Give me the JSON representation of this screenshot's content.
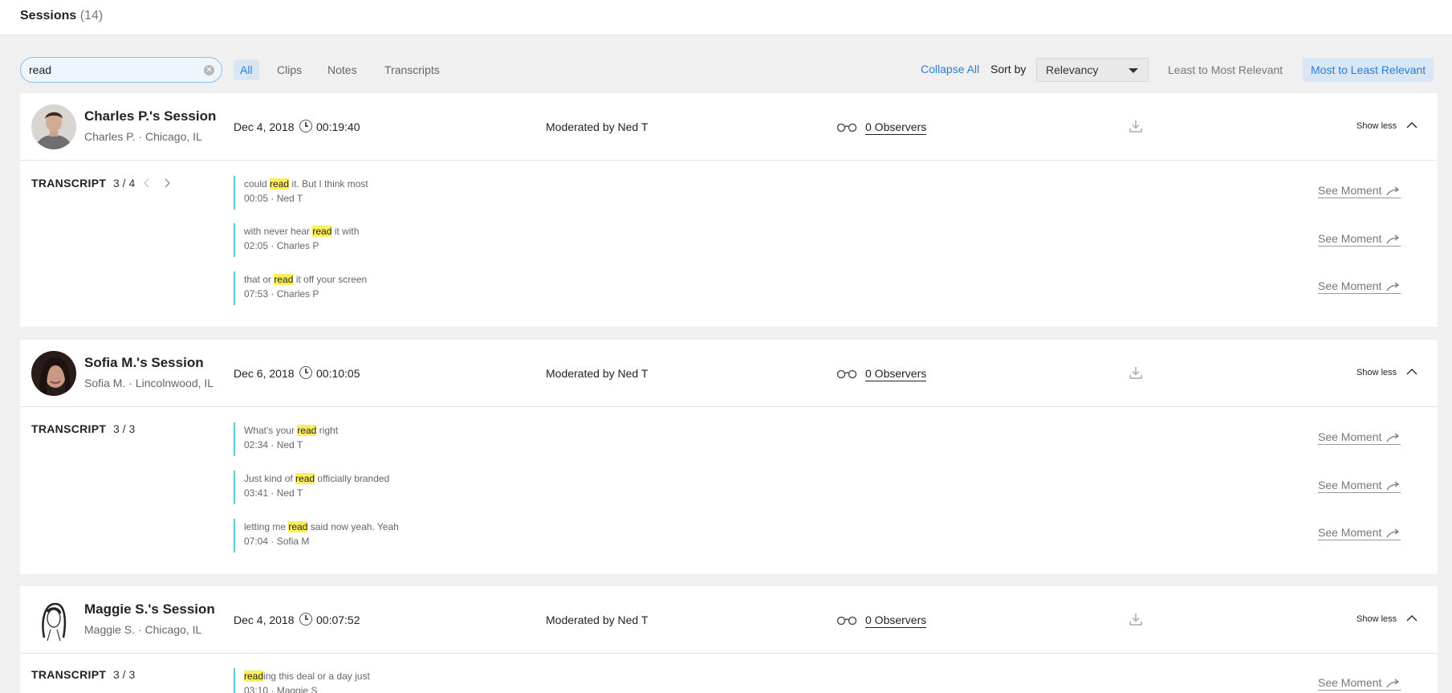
{
  "header": {
    "title": "Sessions",
    "count": "(14)"
  },
  "search": {
    "value": "read"
  },
  "filters": [
    "All",
    "Clips",
    "Notes",
    "Transcripts"
  ],
  "toolbar": {
    "collapse_all": "Collapse All",
    "sort_label": "Sort by",
    "sort_value": "Relevancy",
    "order_asc": "Least to Most Relevant",
    "order_desc": "Most to Least Relevant"
  },
  "sessions": [
    {
      "title": "Charles P.'s Session",
      "subtitle": "Charles P. · Chicago, IL",
      "date": "Dec 4, 2018",
      "duration": "00:19:40",
      "moderator": "Moderated by Ned T",
      "observers": "0 Observers",
      "toggle": "Show less",
      "transcript_label": "TRANSCRIPT",
      "transcript_count": "3 / 4",
      "moments": [
        {
          "before": "could ",
          "hl": "read",
          "after": " it. But I think most",
          "meta": "00:05 · Ned T",
          "link": "See Moment"
        },
        {
          "before": "with never hear ",
          "hl": "read",
          "after": " it with",
          "meta": "02:05 · Charles P",
          "link": "See Moment"
        },
        {
          "before": "that or ",
          "hl": "read",
          "after": " it off your screen",
          "meta": "07:53 · Charles P",
          "link": "See Moment"
        }
      ]
    },
    {
      "title": "Sofia M.'s Session",
      "subtitle": "Sofia M. · Lincolnwood, IL",
      "date": "Dec 6, 2018",
      "duration": "00:10:05",
      "moderator": "Moderated by Ned T",
      "observers": "0 Observers",
      "toggle": "Show less",
      "transcript_label": "TRANSCRIPT",
      "transcript_count": "3 / 3",
      "moments": [
        {
          "before": "What's your ",
          "hl": "read",
          "after": " right",
          "meta": "02:34 · Ned T",
          "link": "See Moment"
        },
        {
          "before": "Just kind of ",
          "hl": "read",
          "after": " officially branded",
          "meta": "03:41 · Ned T",
          "link": "See Moment"
        },
        {
          "before": "letting me ",
          "hl": "read",
          "after": " said now yeah. Yeah",
          "meta": "07:04 · Sofia M",
          "link": "See Moment"
        }
      ]
    },
    {
      "title": "Maggie S.'s Session",
      "subtitle": "Maggie S. · Chicago, IL",
      "date": "Dec 4, 2018",
      "duration": "00:07:52",
      "moderator": "Moderated by Ned T",
      "observers": "0 Observers",
      "toggle": "Show less",
      "transcript_label": "TRANSCRIPT",
      "transcript_count": "3 / 3",
      "moments": [
        {
          "before": "",
          "hl": "read",
          "after": "ing this deal or a day just",
          "meta": "03:10 · Maggie S",
          "link": "See Moment"
        }
      ]
    }
  ]
}
